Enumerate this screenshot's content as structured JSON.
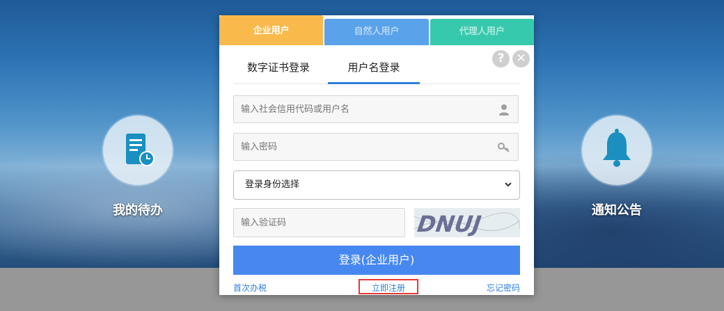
{
  "features": {
    "todo": {
      "label": "我的待办",
      "icon": "document-clock-icon"
    },
    "notice": {
      "label": "通知公告",
      "icon": "bell-icon"
    }
  },
  "tabs": [
    {
      "label": "企业用户",
      "color": "#f9b94b"
    },
    {
      "label": "自然人用户",
      "color": "#5aa2ea"
    },
    {
      "label": "代理人用户",
      "color": "#37c9ad"
    }
  ],
  "subtabs": {
    "cert": "数字证书登录",
    "username": "用户名登录"
  },
  "form": {
    "username_placeholder": "输入社会信用代码或用户名",
    "password_placeholder": "输入密码",
    "role_select": "登录身份选择",
    "captcha_placeholder": "输入验证码",
    "captcha_text": "DNUJ",
    "login_label": "登录(企业用户)"
  },
  "links": {
    "first_tax": "首次办税",
    "register": "立即注册",
    "forgot": "忘记密码"
  },
  "colors": {
    "accent": "#4788f0",
    "active_underline": "#2f7fd8",
    "highlight_box": "#e53935"
  }
}
